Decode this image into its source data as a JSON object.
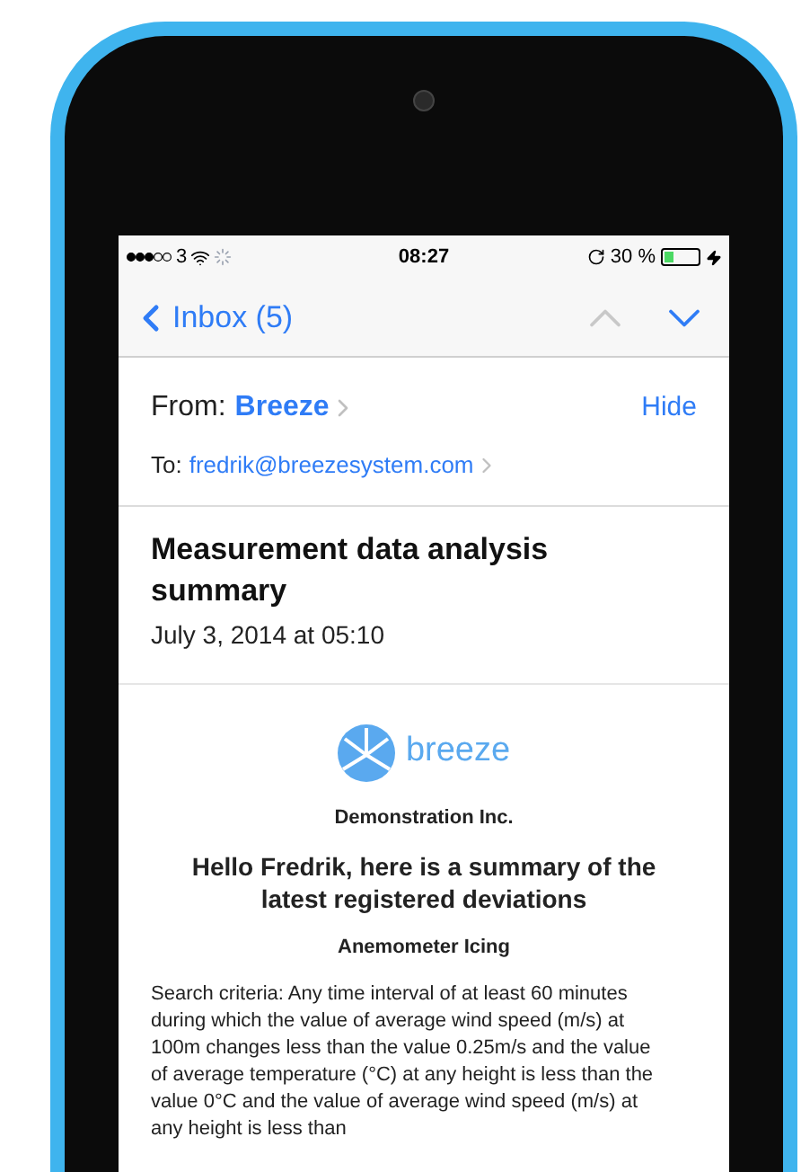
{
  "status_bar": {
    "carrier": "3",
    "time": "08:27",
    "battery_text": "30 %",
    "battery": {
      "level": 0.3
    }
  },
  "nav": {
    "back": "Inbox (5)",
    "previous_disabled": true,
    "next_disabled": false
  },
  "header": {
    "from_label": "From:",
    "from_name": "Breeze",
    "hide": "Hide",
    "to_label": "To:",
    "to_address": "fredrik@breezesystem.com"
  },
  "subject": "Measurement data analysis summary",
  "date": "July 3, 2014 at 05:10",
  "body": {
    "logo_text": "breeze",
    "company": "Demonstration Inc.",
    "greeting": "Hello Fredrik, here is a summary of the latest registered deviations",
    "section": "Anemometer Icing",
    "criteria": "Search criteria: Any time interval of at least 60 minutes during which the value of average wind speed (m/s) at 100m changes less than the value 0.25m/s and the value of average temperature (°C) at any height is less than the value 0°C and the value of average wind speed (m/s) at any height is less than"
  }
}
